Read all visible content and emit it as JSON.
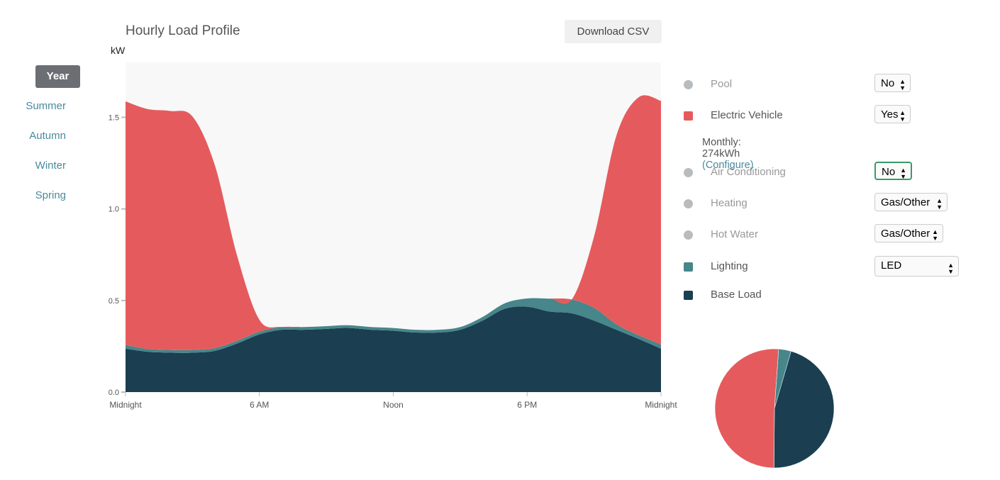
{
  "nav": {
    "items": [
      {
        "label": "Year",
        "active": true
      },
      {
        "label": "Summer"
      },
      {
        "label": "Autumn"
      },
      {
        "label": "Winter"
      },
      {
        "label": "Spring"
      }
    ]
  },
  "header": {
    "title": "Hourly Load Profile",
    "download_label": "Download CSV"
  },
  "legend": {
    "items": [
      {
        "label": "Pool",
        "value": "No",
        "color": "#b8bcbf",
        "active": false
      },
      {
        "label": "Electric Vehicle",
        "value": "Yes",
        "color": "#e55b5d",
        "active": true
      },
      {
        "label": "Air Conditioning",
        "value": "No",
        "color": "#b8bcbf",
        "active": false
      },
      {
        "label": "Heating",
        "value": "Gas/Other",
        "color": "#b8bcbf",
        "active": false
      },
      {
        "label": "Hot Water",
        "value": "Gas/Other",
        "color": "#b8bcbf",
        "active": false
      },
      {
        "label": "Lighting",
        "value": "LED",
        "color": "#47868a",
        "active": true
      },
      {
        "label": "Base Load",
        "value": null,
        "color": "#1b3e51",
        "active": true
      }
    ],
    "monthly_prefix": "Monthly: 274kWh",
    "configure_link": "(Configure)"
  },
  "chart_data": [
    {
      "type": "area",
      "stacked": true,
      "ylabel": "kW",
      "ylim": [
        0,
        1.8
      ],
      "yticks": [
        "0.0",
        "0.5",
        "1.0",
        "1.5"
      ],
      "xlim": [
        0,
        24
      ],
      "xticks": [
        {
          "h": 0,
          "label": "Midnight"
        },
        {
          "h": 6,
          "label": "6 AM"
        },
        {
          "h": 12,
          "label": "Noon"
        },
        {
          "h": 18,
          "label": "6 PM"
        },
        {
          "h": 24,
          "label": "Midnight"
        }
      ],
      "hours": [
        0,
        1,
        2,
        3,
        4,
        5,
        6,
        7,
        8,
        9,
        10,
        11,
        12,
        13,
        14,
        15,
        16,
        17,
        18,
        19,
        20,
        21,
        22,
        23,
        24
      ],
      "series": [
        {
          "name": "Base Load",
          "color": "#1b3e51",
          "values": [
            0.237,
            0.22,
            0.215,
            0.215,
            0.225,
            0.265,
            0.315,
            0.34,
            0.34,
            0.345,
            0.35,
            0.34,
            0.335,
            0.325,
            0.325,
            0.34,
            0.39,
            0.455,
            0.466,
            0.44,
            0.43,
            0.39,
            0.34,
            0.29,
            0.237
          ]
        },
        {
          "name": "Lighting",
          "color": "#47868a",
          "values": [
            0.02,
            0.015,
            0.015,
            0.015,
            0.015,
            0.015,
            0.015,
            0.015,
            0.015,
            0.015,
            0.015,
            0.015,
            0.015,
            0.015,
            0.015,
            0.015,
            0.02,
            0.03,
            0.045,
            0.07,
            0.075,
            0.07,
            0.03,
            0.02,
            0.023
          ]
        },
        {
          "name": "Electric Vehicle",
          "color": "#e55b5d",
          "values": [
            1.33,
            1.31,
            1.305,
            1.275,
            1.0,
            0.465,
            0.065,
            0,
            0,
            0,
            0,
            0,
            0,
            0,
            0,
            0,
            0,
            0,
            0,
            0,
            0,
            0.39,
            1.03,
            1.3,
            1.33
          ]
        }
      ],
      "background": "#f8f8f8"
    },
    {
      "type": "pie",
      "slices": [
        {
          "name": "Lighting",
          "value": 3.4,
          "color": "#47868a"
        },
        {
          "name": "Base Load",
          "value": 45.6,
          "color": "#1b3e51"
        },
        {
          "name": "Electric Vehicle",
          "value": 51.0,
          "color": "#e55b5d"
        }
      ]
    }
  ]
}
